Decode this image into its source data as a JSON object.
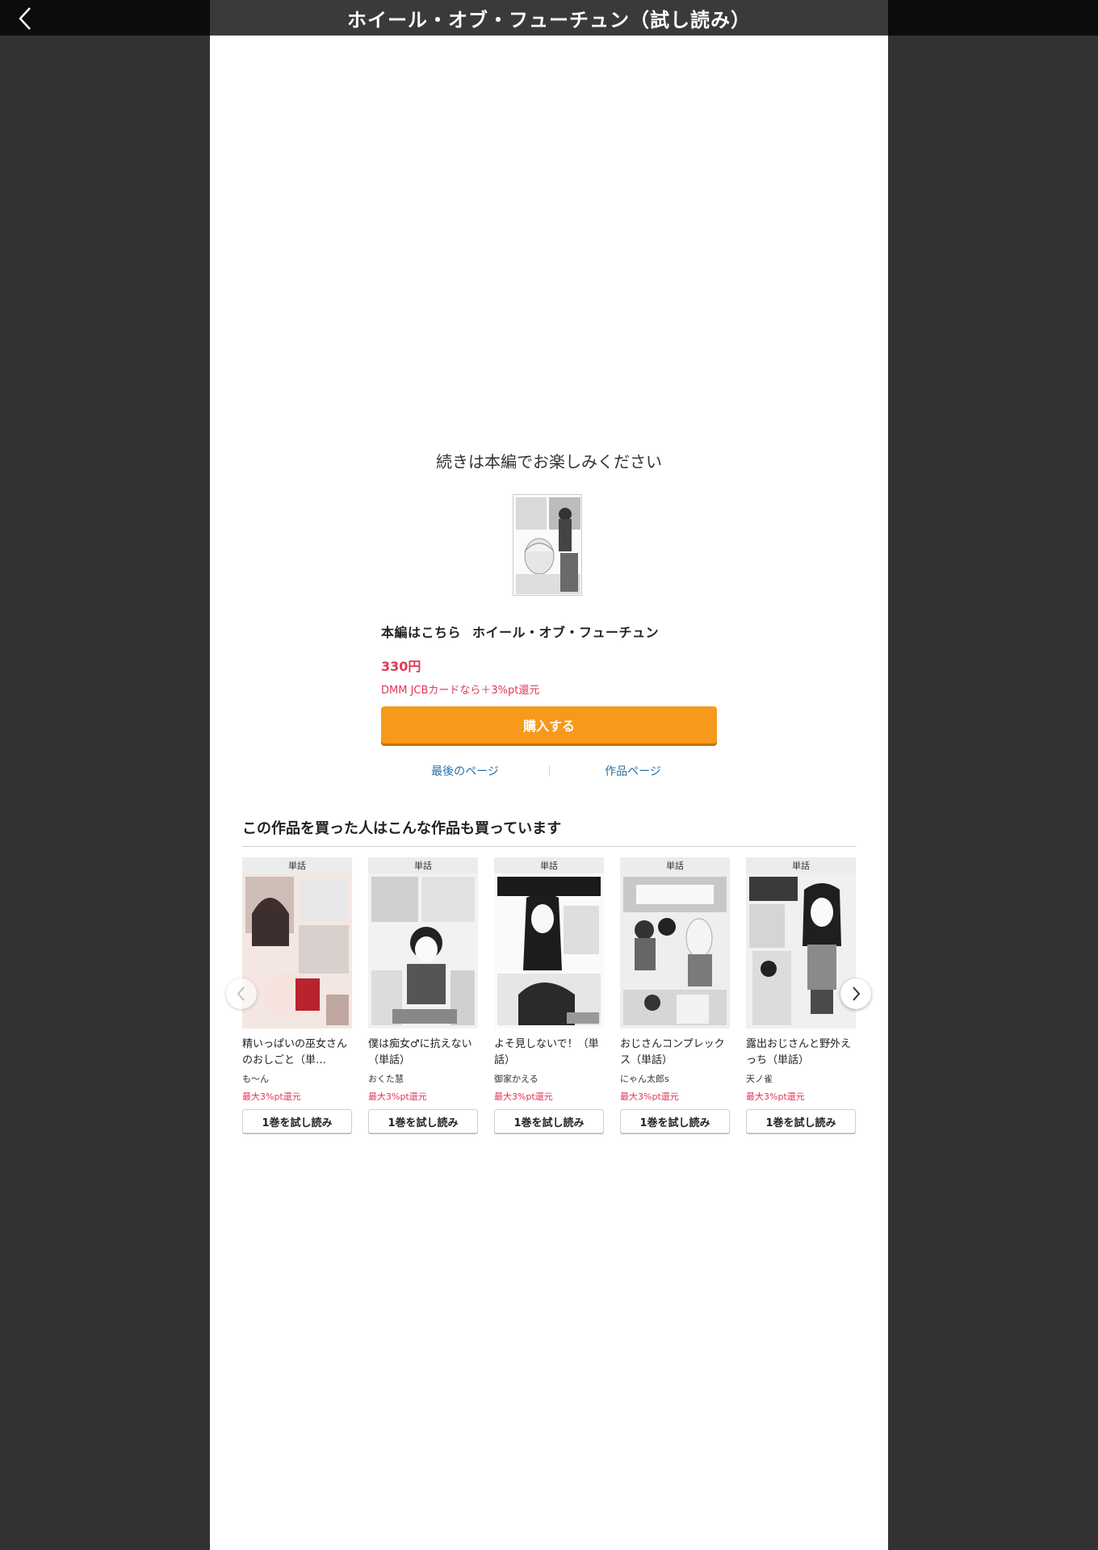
{
  "header": {
    "title": "ホイール・オブ・フューチュン（試し読み）"
  },
  "end_panel": {
    "continue_text": "続きは本編でお楽しみください",
    "product_prefix": "本編はこちら",
    "product_title": "ホイール・オブ・フューチュン",
    "price": "330円",
    "point_note": "DMM JCBカードなら＋3%pt還元",
    "buy_label": "購入する",
    "last_page_label": "最後のページ",
    "work_page_label": "作品ページ"
  },
  "recommendations": {
    "heading": "この作品を買った人はこんな作品も買っています",
    "items": [
      {
        "tag": "単話",
        "title": "精いっぱいの巫女さんのおしごと（単…",
        "author": "も〜ん",
        "points": "最大3%pt還元",
        "button": "1巻を試し読み"
      },
      {
        "tag": "単話",
        "title": "僕は痴女♂に抗えない（単話）",
        "author": "おくた慧",
        "points": "最大3%pt還元",
        "button": "1巻を試し読み"
      },
      {
        "tag": "単話",
        "title": "よそ見しないで！（単話）",
        "author": "御家かえる",
        "points": "最大3%pt還元",
        "button": "1巻を試し読み"
      },
      {
        "tag": "単話",
        "title": "おじさんコンプレックス（単話）",
        "author": "にゃん太郎s",
        "points": "最大3%pt還元",
        "button": "1巻を試し読み"
      },
      {
        "tag": "単話",
        "title": "露出おじさんと野外えっち（単話）",
        "author": "天ノ雀",
        "points": "最大3%pt還元",
        "button": "1巻を試し読み"
      }
    ]
  },
  "icons": {
    "back": "chevron-left-icon",
    "prev": "chevron-left-icon",
    "next": "chevron-right-icon"
  },
  "colors": {
    "accent_orange": "#f7991b",
    "price_red": "#e0375a",
    "link_blue": "#2a6fa3",
    "viewer_bg": "#323232"
  }
}
